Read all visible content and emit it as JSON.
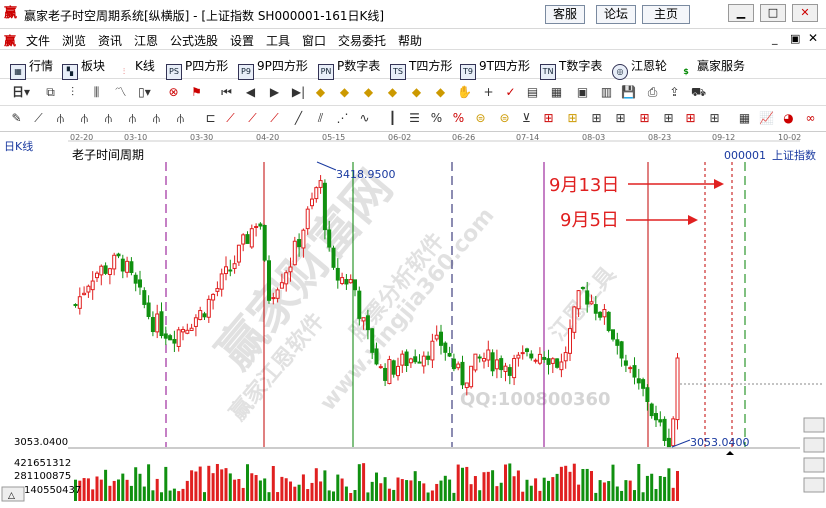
{
  "window": {
    "title": "赢家老子时空周期系统[纵横版] - [上证指数  SH000001-161日K线]",
    "buttons": {
      "service": "客服",
      "forum": "论坛",
      "home": "主页"
    }
  },
  "menu": [
    "文件",
    "浏览",
    "资讯",
    "江恩",
    "公式选股",
    "设置",
    "工具",
    "窗口",
    "交易委托",
    "帮助"
  ],
  "toolbar1": [
    {
      "label": "行情",
      "icon": "quote-icon"
    },
    {
      "label": "板块",
      "icon": "sector-icon"
    },
    {
      "label": "K线",
      "icon": "kline-icon"
    },
    {
      "label": "P四方形",
      "icon": "p-square-icon",
      "badge": "PS"
    },
    {
      "label": "9P四方形",
      "icon": "9p-square-icon",
      "badge": "P9"
    },
    {
      "label": "P数字表",
      "icon": "p-number-table-icon",
      "badge": "PN"
    },
    {
      "label": "T四方形",
      "icon": "t-square-icon",
      "badge": "TS"
    },
    {
      "label": "9T四方形",
      "icon": "9t-square-icon",
      "badge": "T9"
    },
    {
      "label": "T数字表",
      "icon": "t-number-table-icon",
      "badge": "TN"
    },
    {
      "label": "江恩轮",
      "icon": "gann-wheel-icon"
    },
    {
      "label": "赢家服务",
      "icon": "dollar-icon"
    }
  ],
  "chart": {
    "period_label": "日K线",
    "indicator_title": "老子时间周期",
    "symbol_code": "000001",
    "symbol_name": "上证指数",
    "date_axis": [
      "02-20",
      "03-10",
      "03-30",
      "04-20",
      "05-15",
      "06-02",
      "06-26",
      "07-14",
      "08-03",
      "08-23",
      "09-12",
      "10-02"
    ],
    "high_label": "3418.9500",
    "low_label": "3053.0400",
    "left_price": "3053.0400",
    "volume_labels": [
      "421651312",
      "281100875",
      "140550437"
    ],
    "annotation_sep13": "9月13日",
    "annotation_sep5": "9月5日",
    "watermark": [
      "赢家财富网",
      "赢家江恩软件",
      "股票分析软件",
      "江恩工具",
      "www.yingjia360.com"
    ],
    "qq": "QQ:100800360",
    "colors": {
      "up": "#e02020",
      "down": "#109010",
      "cycle_red": "#c00000",
      "cycle_green": "#008000",
      "cycle_purple": "#8b008b",
      "cycle_navy": "#1a1a66"
    }
  },
  "chart_data": {
    "type": "candlestick",
    "title": "老子时间周期",
    "series_name": "上证指数",
    "price_range": [
      3053.04,
      3418.95
    ],
    "high": 3418.95,
    "low": 3053.04,
    "annotations": [
      {
        "text": "9月13日"
      },
      {
        "text": "9月5日"
      }
    ]
  }
}
